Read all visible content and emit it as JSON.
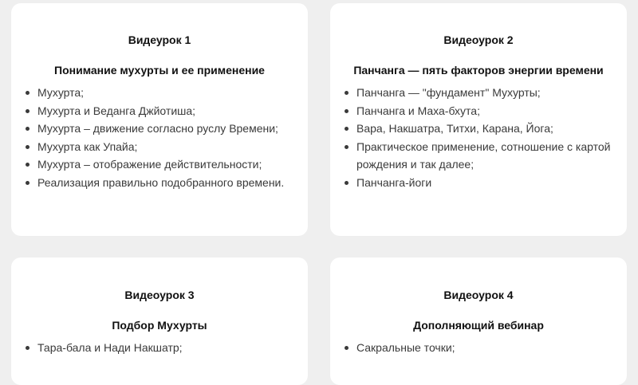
{
  "colors": {
    "page_background": "#efefef",
    "card_background": "#ffffff",
    "heading_text": "#111111",
    "body_text": "#3a3a3a"
  },
  "cards": [
    {
      "title": "Видеурок 1",
      "subtitle": "Понимание мухурты и ее применение",
      "items": [
        "Мухурта;",
        "Мухурта и Веданга Джйотиша;",
        "Мухурта – движение согласно руслу Времени;",
        "Мухурта как Упайа;",
        "Мухурта – отображение действительности;",
        "Реализация правильно подобранного времени."
      ]
    },
    {
      "title": "Видеоурок 2",
      "subtitle": "Панчанга — пять факторов энергии времени",
      "items": [
        "Панчанга — \"фундамент\" Мухурты;",
        "Панчанга и Маха-бхута;",
        "Вара, Накшатра, Титхи, Карана, Йога;",
        "Практическое применение, сотношение с картой рождения и так далее;",
        "Панчанга-йоги"
      ]
    },
    {
      "title": "Видеоурок 3",
      "subtitle": "Подбор Мухурты",
      "items": [
        "Тара-бала и Нади Накшатр;"
      ]
    },
    {
      "title": "Видеоурок 4",
      "subtitle": "Дополняющий вебинар",
      "items": [
        "Сакральные точки;"
      ]
    }
  ]
}
